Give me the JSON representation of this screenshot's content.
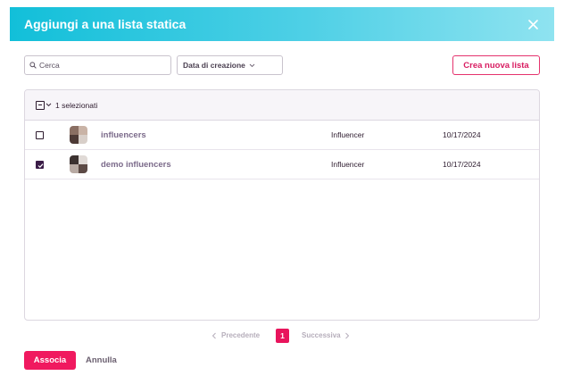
{
  "dialog": {
    "title": "Aggiungi a una lista statica",
    "close_icon": "close-icon"
  },
  "toolbar": {
    "search_placeholder": "Cerca",
    "search_value": "",
    "sort_label": "Data di creazione",
    "create_label": "Crea nuova lista"
  },
  "table": {
    "selected_text": "1 selezionati",
    "rows": [
      {
        "name": "influencers",
        "type": "Influencer",
        "date": "10/17/2024",
        "checked": false
      },
      {
        "name": "demo influencers",
        "type": "Influencer",
        "date": "10/17/2024",
        "checked": true
      }
    ]
  },
  "pagination": {
    "prev_label": "Precedente",
    "current_page": "1",
    "next_label": "Successiva"
  },
  "footer": {
    "associate_label": "Associa",
    "cancel_label": "Annulla"
  },
  "colors": {
    "header_gradient_start": "#12bfd9",
    "header_gradient_end": "#8fe3f0",
    "primary": "#f0195f",
    "checkbox_checked": "#3a1c47"
  }
}
